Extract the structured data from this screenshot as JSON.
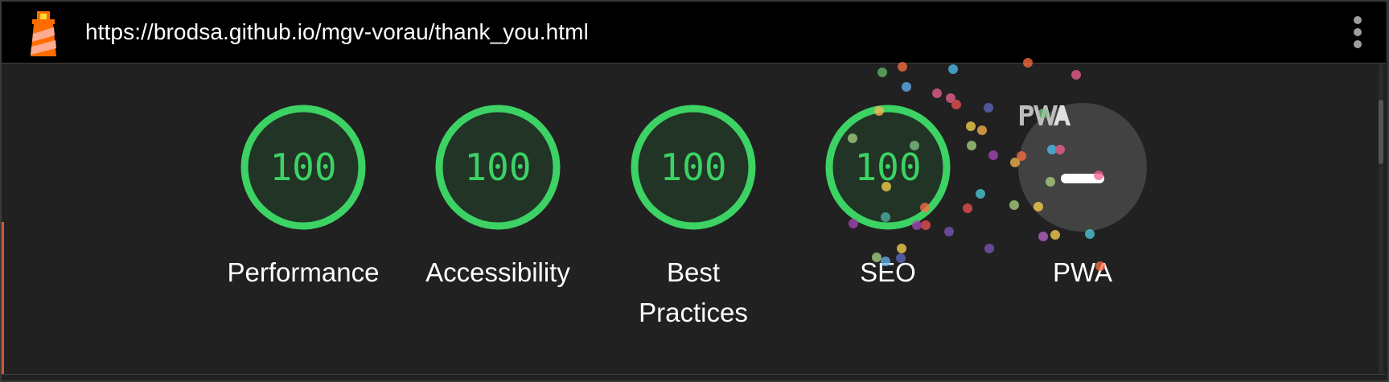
{
  "browser": {
    "url": "https://brodsa.github.io/mgv-vorau/thank_you.html",
    "logo_icon": "lighthouse-icon",
    "menu_icon": "kebab-menu-icon"
  },
  "theme": {
    "pass_color": "#3cd264",
    "pwa_gray": "#424242"
  },
  "gauges": [
    {
      "category": "Performance",
      "score": "100"
    },
    {
      "category": "Accessibility",
      "score": "100"
    },
    {
      "category": "Best Practices",
      "score": "100"
    },
    {
      "category": "SEO",
      "score": "100"
    }
  ],
  "pwa": {
    "category": "PWA",
    "icon": "pwa-logo-icon"
  }
}
